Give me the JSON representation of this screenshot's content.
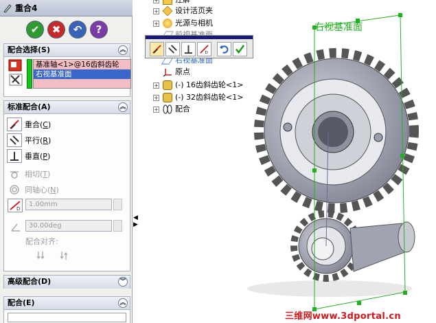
{
  "property_manager": {
    "title": "重合4",
    "buttons": {
      "ok": "✔",
      "cancel": "✖",
      "undo": "↶",
      "help": "?"
    },
    "mate_selections": {
      "header": "配合选择(S)",
      "items": [
        "基准轴<1>@16齿斜齿轮",
        "右视基准面"
      ]
    },
    "standard_mates": {
      "header": "标准配合(A)",
      "mates": [
        {
          "label": "重合",
          "key": "C",
          "enabled": true
        },
        {
          "label": "平行",
          "key": "R",
          "enabled": true
        },
        {
          "label": "垂直",
          "key": "P",
          "enabled": true
        },
        {
          "label": "相切",
          "key": "T",
          "enabled": false
        },
        {
          "label": "同轴心",
          "key": "N",
          "enabled": false
        }
      ],
      "distance_value": "1.00mm",
      "angle_value": "30.00deg",
      "alignment_label": "配合对齐:"
    },
    "advanced_mates": {
      "header": "高级配合(D)"
    },
    "mates_section": {
      "header": "配合(E)"
    }
  },
  "feature_tree": {
    "nodes": [
      {
        "label": "注解",
        "expandable": true
      },
      {
        "label": "设计活页夹",
        "expandable": true
      },
      {
        "label": "光源与相机",
        "expandable": true
      },
      {
        "label": "前视基准面",
        "expandable": false
      },
      {
        "label": "右视基准面",
        "expandable": false
      },
      {
        "label": "原点",
        "expandable": false
      },
      {
        "label": "(-) 16齿斜齿轮<1>",
        "expandable": true
      },
      {
        "label": "(-) 32齿斜齿轮<1>",
        "expandable": true
      },
      {
        "label": "配合",
        "expandable": true
      }
    ]
  },
  "viewport": {
    "plane_label": "右视基准面",
    "watermark": "三维网www.3dportal.cn"
  },
  "colors": {
    "selection": "#3a66c8",
    "valid": "#17c41a",
    "plane": "#21b021",
    "watermark": "#d0181c"
  }
}
